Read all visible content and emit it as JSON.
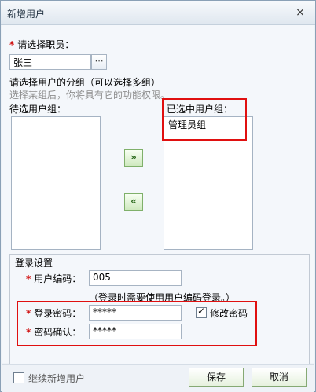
{
  "window": {
    "title": "新增用户",
    "close_glyph": "×"
  },
  "staff": {
    "label": "请选择职员：",
    "value": "张三",
    "browse_glyph": "⋯"
  },
  "groups": {
    "heading": "请选择用户的分组（可以选择多组）",
    "hint": "选择某组后，你将具有它的功能权限。",
    "available_label": "待选用户组：",
    "selected_label": "已选中用户组：",
    "selected_items": [
      "管理员组"
    ],
    "add_label": "»",
    "remove_label": "«"
  },
  "login": {
    "section_title": "登录设置",
    "code_label": "用户编码：",
    "code_value": "005",
    "code_hint": "（登录时需要使用用户编码登录。）",
    "password_label": "登录密码：",
    "password_value": "*****",
    "confirm_label": "密码确认：",
    "confirm_value": "*****",
    "change_password_label": "修改密码"
  },
  "footer": {
    "continue_label": "继续新增用户",
    "save_label": "保存",
    "cancel_label": "取消"
  }
}
